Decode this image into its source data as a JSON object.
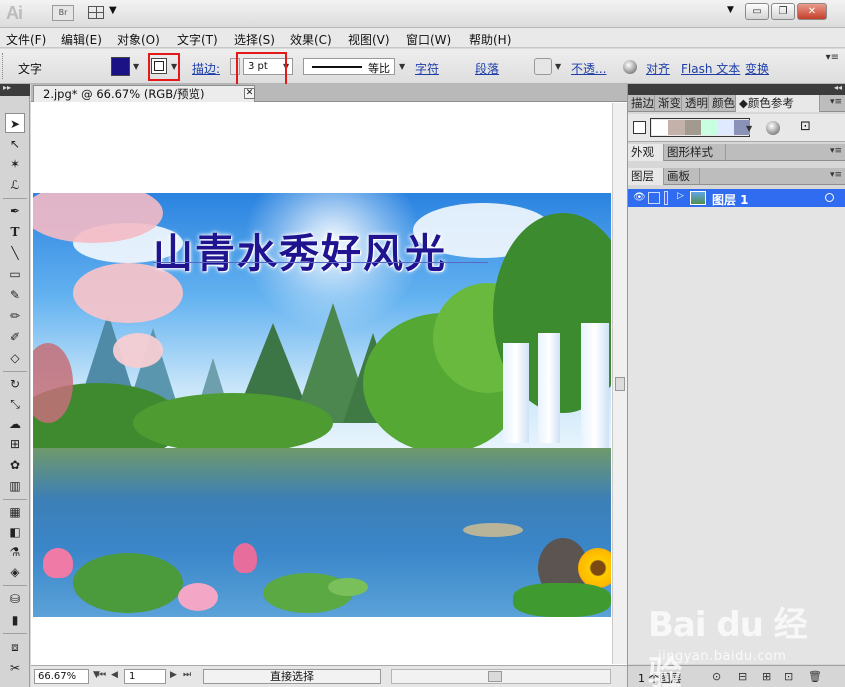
{
  "app": {
    "logo": "Ai",
    "bridge_label": "Br"
  },
  "window_controls": {
    "minimize": "▭",
    "restore": "❐",
    "close": "✕"
  },
  "menu": [
    "文件(F)",
    "编辑(E)",
    "对象(O)",
    "文字(T)",
    "选择(S)",
    "效果(C)",
    "视图(V)",
    "窗口(W)",
    "帮助(H)"
  ],
  "control_bar": {
    "tool_label": "文字",
    "fill_color": "#1a1285",
    "stroke_label": "描边:",
    "stroke_weight": "3 pt",
    "stroke_profile": "等比",
    "character_link": "字符",
    "paragraph_link": "段落",
    "opacity_link": "不透...",
    "align_link": "对齐",
    "flash_text_link": "Flash 文本",
    "transform_link": "变换"
  },
  "document": {
    "tab_title": "2.jpg* @ 66.67% (RGB/预览)",
    "tab_close": "✕",
    "artwork_title": "山青水秀好风光"
  },
  "status_bar": {
    "zoom": "66.67%",
    "page": "1",
    "status_text": "直接选择"
  },
  "tools": [
    "selection-tool",
    "direct-selection-tool",
    "magic-wand-tool",
    "lasso-tool",
    "pen-tool",
    "type-tool",
    "line-segment-tool",
    "rectangle-tool",
    "paintbrush-tool",
    "pencil-tool",
    "blob-brush-tool",
    "eraser-tool",
    "rotate-tool",
    "scale-tool",
    "warp-tool",
    "free-transform-tool",
    "symbol-sprayer-tool",
    "column-graph-tool",
    "mesh-tool",
    "gradient-tool",
    "eyedropper-tool",
    "blend-tool",
    "live-paint-bucket-tool",
    "live-paint-selection-tool",
    "artboard-tool",
    "slice-tool",
    "hand-tool",
    "zoom-tool"
  ],
  "panels": {
    "group1_tabs": [
      "描边",
      "渐变",
      "透明",
      "颜色",
      "颜色参考"
    ],
    "group2_tabs": [
      "外观",
      "图形样式"
    ],
    "group3_tabs": [
      "图层",
      "画板"
    ],
    "guide_colors": [
      "#ffffff",
      "#c4b2aa",
      "#a39a8f",
      "#c9ffe1",
      "#dfe9ff",
      "#8b92b8"
    ],
    "layers": [
      {
        "name": "图层 1",
        "color": "#4b62ff"
      }
    ],
    "layer_count": "1 个图层"
  },
  "watermark": {
    "logo": "Bai du 经验",
    "url": "jingyan.baidu.com"
  },
  "colors": {
    "highlight": "#e31919",
    "layer_selection": "#2f6cf0",
    "link": "#1d3ea8"
  }
}
